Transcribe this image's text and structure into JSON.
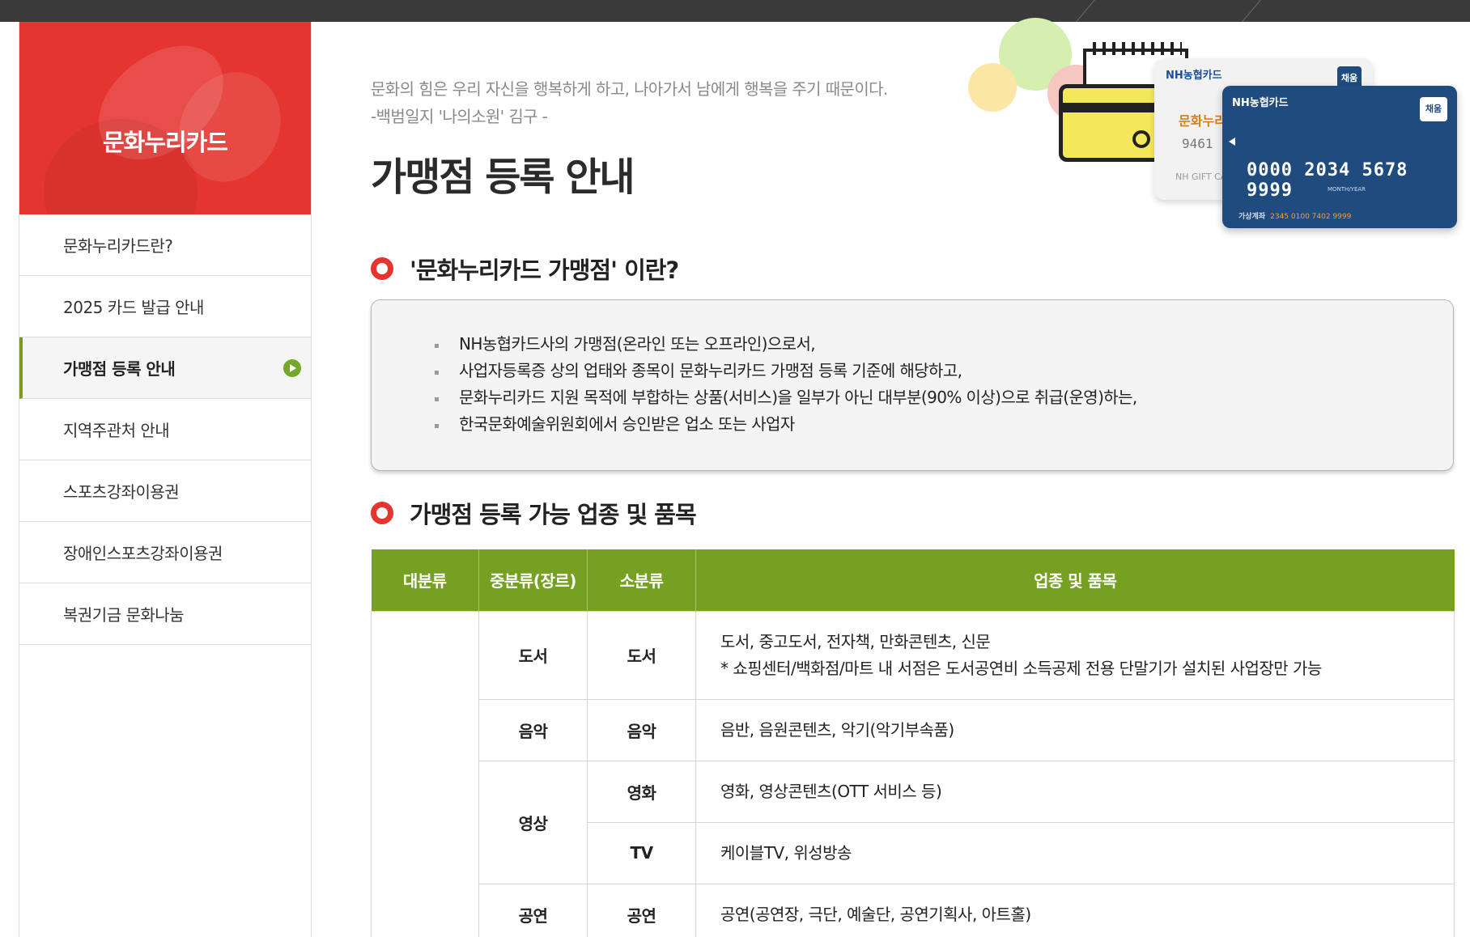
{
  "sidebar": {
    "title": "문화누리카드",
    "items": [
      {
        "label": "문화누리카드란?"
      },
      {
        "label": "2025 카드 발급 안내"
      },
      {
        "label": "가맹점 등록 안내"
      },
      {
        "label": "지역주관처 안내"
      },
      {
        "label": "스포츠강좌이용권"
      },
      {
        "label": "장애인스포츠강좌이용권"
      },
      {
        "label": "복권기금 문화나눔"
      }
    ],
    "active_index": 2
  },
  "main": {
    "quote_line1": "문화의 힘은 우리 자신을 행복하게 하고, 나아가서 남에게 행복을 주기 때문이다.",
    "quote_line2": "-백범일지 '나의소원' 김구 -",
    "page_title": "가맹점 등록 안내",
    "section1_title": "'문화누리카드 가맹점' 이란?",
    "section1_items": [
      "NH농협카드사의 가맹점(온라인 또는 오프라인)으로서,",
      "사업자등록증 상의 업태와 종목이 문화누리카드 가맹점 등록 기준에 해당하고,",
      "문화누리카드 지원 목적에 부합하는 상품(서비스)을 일부가 아닌 대부분(90% 이상)으로 취급(운영)하는,",
      "한국문화예술위원회에서 승인받은 업소 또는 사업자"
    ],
    "section2_title": "가맹점 등록 가능 업종 및 품목",
    "table": {
      "headers": [
        "대분류",
        "중분류(장르)",
        "소분류",
        "업종 및 품목"
      ],
      "rows": [
        {
          "mid": "도서",
          "sub": "도서",
          "desc1": "도서, 중고도서, 전자책, 만화콘텐츠, 신문",
          "desc2": "* 쇼핑센터/백화점/마트 내 서점은 도서공연비 소득공제 전용 단말기가 설치된 사업장만 가능"
        },
        {
          "mid": "음악",
          "sub": "음악",
          "desc1": "음반, 음원콘텐츠, 악기(악기부속품)"
        },
        {
          "mid": "영상",
          "sub": "영화",
          "desc1": "영화, 영상콘텐츠(OTT 서비스 등)"
        },
        {
          "sub": "TV",
          "desc1": "케이블TV, 위성방송"
        },
        {
          "mid": "공연",
          "sub": "공연",
          "desc1": "공연(공연장, 극단, 예술단, 공연기획사, 아트홀)"
        }
      ]
    }
  },
  "illustration": {
    "white_card_bank": "NH농협카드",
    "white_card_name": "문화누리",
    "white_card_num": "9461",
    "white_card_gift": "NH GIFT CA",
    "white_card_badge": "채움",
    "blue_card_bank": "NH농협카드",
    "blue_card_badge": "채움",
    "blue_card_number": "0000 2034 5678 9999",
    "blue_card_expiry": "MONTH/YEAR",
    "blue_card_account_label": "가상계좌",
    "blue_card_account": "2345 0100 7402 9999"
  },
  "colors": {
    "accent_red": "#e53530",
    "table_green": "#76a021",
    "active_marker": "#74a82a",
    "topbar": "#3a3a3a"
  }
}
